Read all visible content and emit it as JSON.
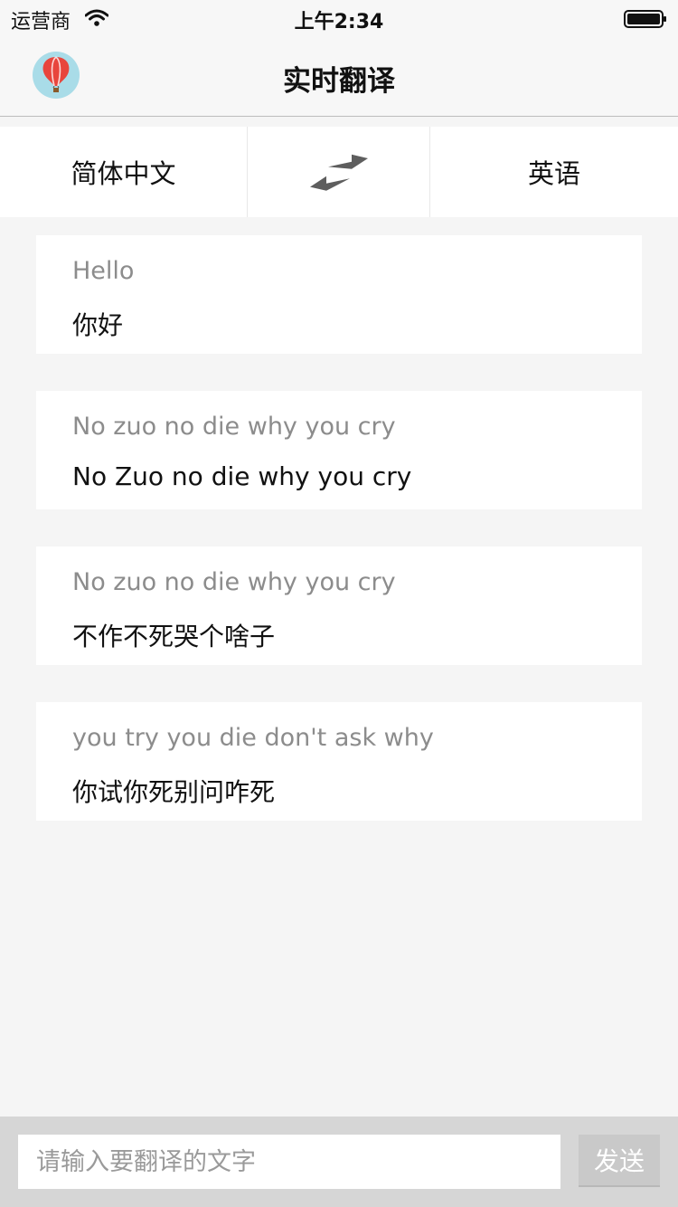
{
  "status_bar": {
    "carrier": "运营商",
    "time": "上午2:34",
    "icons": [
      "wifi-icon",
      "battery-icon"
    ]
  },
  "nav": {
    "title": "实时翻译",
    "avatar_icon": "hot-air-balloon-icon"
  },
  "languages": {
    "source": "简体中文",
    "target": "英语",
    "swap_icon": "swap-arrows-icon"
  },
  "translations": [
    {
      "source": "Hello",
      "result": "你好"
    },
    {
      "source": "No zuo no die why you cry",
      "result": "No Zuo no die why you cry"
    },
    {
      "source": "No zuo no die why you cry",
      "result": "不作不死哭个啥子"
    },
    {
      "source": "you try you die don't ask why",
      "result": "你试你死别问咋死"
    }
  ],
  "input_bar": {
    "placeholder": "请输入要翻译的文字",
    "value": "",
    "send_label": "发送"
  },
  "colors": {
    "background": "#f5f5f5",
    "card": "#ffffff",
    "secondary_text": "#8c8c8c",
    "balloon_red": "#e8453c",
    "avatar_bg": "#a9dce8"
  }
}
